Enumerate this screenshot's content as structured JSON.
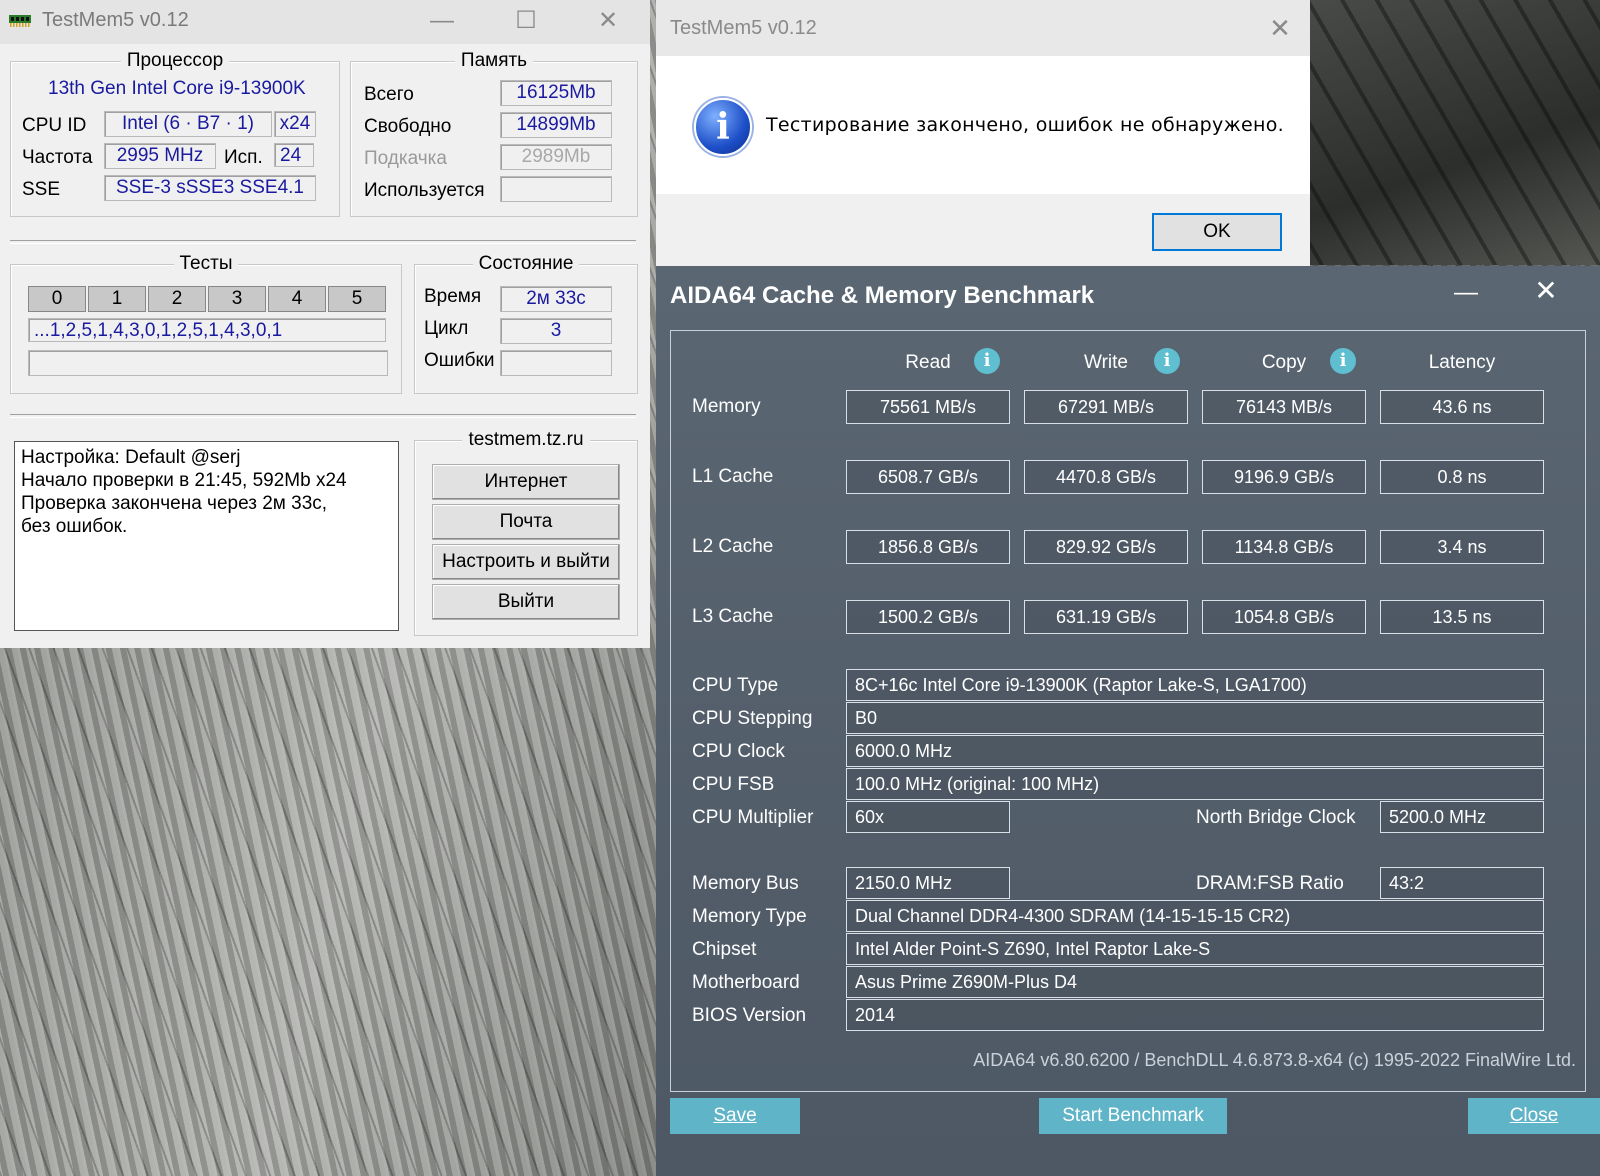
{
  "testmem": {
    "title": "TestMem5 v0.12",
    "processor": {
      "group": "Процессор",
      "model": "13th Gen Intel Core i9-13900K",
      "cpuid_label": "CPU ID",
      "cpuid_value": "Intel  (6 · B7 · 1)",
      "threads": "x24",
      "freq_label": "Частота",
      "freq_value": "2995 MHz",
      "used_label": "Исп.",
      "used_value": "24",
      "sse_label": "SSE",
      "sse_value": "SSE-3 sSSE3 SSE4.1"
    },
    "memory": {
      "group": "Память",
      "total_label": "Всего",
      "total_value": "16125Mb",
      "free_label": "Свободно",
      "free_value": "14899Mb",
      "swap_label": "Подкачка",
      "swap_value": "2989Mb",
      "used_label": "Используется",
      "used_value": ""
    },
    "tests": {
      "group": "Тесты",
      "buttons": [
        "0",
        "1",
        "2",
        "3",
        "4",
        "5"
      ],
      "sequence": "...1,2,5,1,4,3,0,1,2,5,1,4,3,0,1",
      "progress": ""
    },
    "status": {
      "group": "Состояние",
      "time_label": "Время",
      "time_value": "2м 33с",
      "cycle_label": "Цикл",
      "cycle_value": "3",
      "errors_label": "Ошибки",
      "errors_value": ""
    },
    "log": [
      "Настройка: Default @serj",
      "Начало проверки в 21:45, 592Mb x24",
      "Проверка закончена через 2м 33с,",
      "без ошибок."
    ],
    "links": {
      "group": "testmem.tz.ru",
      "internet": "Интернет",
      "mail": "Почта",
      "configure_exit": "Настроить и выйти",
      "exit": "Выйти"
    }
  },
  "msgbox": {
    "title": "TestMem5 v0.12",
    "message": "Тестирование закончено, ошибок не обнаружено.",
    "ok": "OK"
  },
  "aida": {
    "title": "AIDA64 Cache & Memory Benchmark",
    "columns": [
      "Read",
      "Write",
      "Copy",
      "Latency"
    ],
    "rows": [
      {
        "label": "Memory",
        "values": [
          "75561 MB/s",
          "67291 MB/s",
          "76143 MB/s",
          "43.6 ns"
        ]
      },
      {
        "label": "L1 Cache",
        "values": [
          "6508.7 GB/s",
          "4470.8 GB/s",
          "9196.9 GB/s",
          "0.8 ns"
        ]
      },
      {
        "label": "L2 Cache",
        "values": [
          "1856.8 GB/s",
          "829.92 GB/s",
          "1134.8 GB/s",
          "3.4 ns"
        ]
      },
      {
        "label": "L3 Cache",
        "values": [
          "1500.2 GB/s",
          "631.19 GB/s",
          "1054.8 GB/s",
          "13.5 ns"
        ]
      }
    ],
    "cpu": {
      "type_label": "CPU Type",
      "type_value": "8C+16c Intel Core i9-13900K  (Raptor Lake-S, LGA1700)",
      "stepping_label": "CPU Stepping",
      "stepping_value": "B0",
      "clock_label": "CPU Clock",
      "clock_value": "6000.0 MHz",
      "fsb_label": "CPU FSB",
      "fsb_value": "100.0 MHz  (original: 100 MHz)",
      "mult_label": "CPU Multiplier",
      "mult_value": "60x",
      "nb_label": "North Bridge Clock",
      "nb_value": "5200.0 MHz"
    },
    "mem": {
      "bus_label": "Memory Bus",
      "bus_value": "2150.0 MHz",
      "ratio_label": "DRAM:FSB Ratio",
      "ratio_value": "43:2",
      "type_label": "Memory Type",
      "type_value": "Dual Channel DDR4-4300 SDRAM  (14-15-15-15 CR2)",
      "chipset_label": "Chipset",
      "chipset_value": "Intel Alder Point-S Z690, Intel Raptor Lake-S",
      "mb_label": "Motherboard",
      "mb_value": "Asus Prime Z690M-Plus D4",
      "bios_label": "BIOS Version",
      "bios_value": "2014"
    },
    "footer": "AIDA64 v6.80.6200 / BenchDLL 4.6.873.8-x64  (c) 1995-2022 FinalWire Ltd.",
    "buttons": {
      "save": "Save",
      "start": "Start Benchmark",
      "close": "Close"
    }
  }
}
